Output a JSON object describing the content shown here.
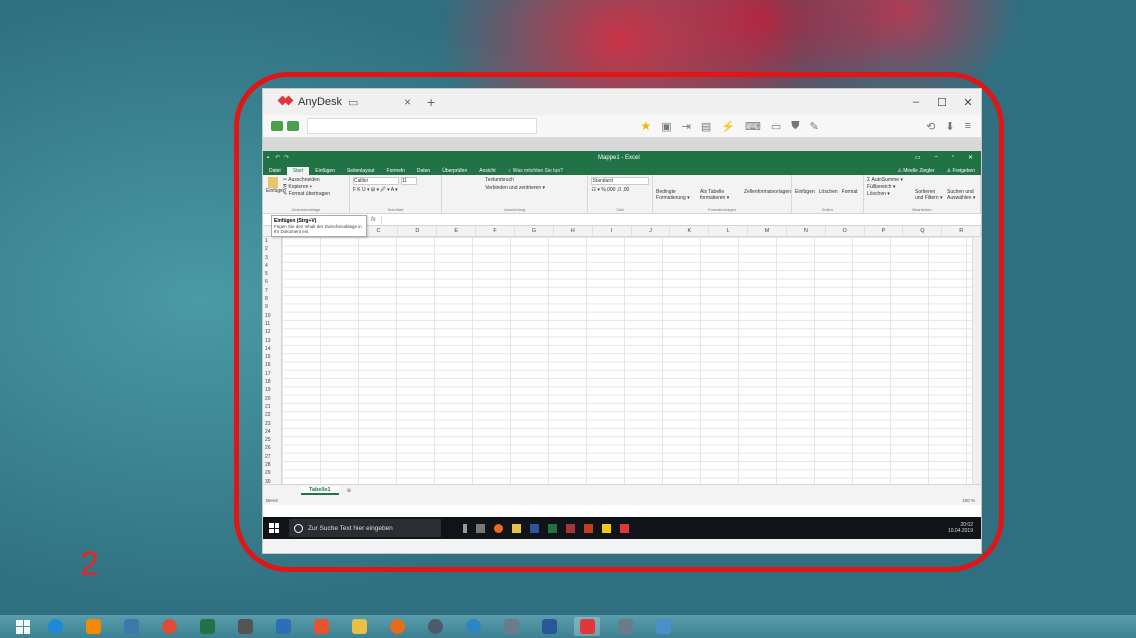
{
  "annotations": {
    "label_1": "1",
    "label_2": "2"
  },
  "anydesk": {
    "tab_title": "AnyDesk",
    "tab_close": "×",
    "new_tab": "+",
    "window_controls": [
      "–",
      "☐",
      "✕"
    ],
    "brand_color": "#e3363b"
  },
  "excel": {
    "window_title": "Mappe1 - Excel",
    "window_controls": [
      "▭",
      "–",
      "▫",
      "✕"
    ],
    "ribbon_tabs": [
      "Datei",
      "Start",
      "Einfügen",
      "Seitenlayout",
      "Formeln",
      "Daten",
      "Überprüfen",
      "Ansicht"
    ],
    "active_tab": "Start",
    "tell_me": "♀ Was möchten Sie tun?",
    "user": "⚠ Mirelle Ziegler",
    "share": "♙ Freigeben",
    "clipboard": {
      "paste": "Einfügen",
      "cut": "✂ Ausschneiden",
      "copy": "⎘ Kopieren ▾",
      "format_painter": "✎ Format übertragen",
      "group": "Zwischenablage"
    },
    "font": {
      "name": "Calibri",
      "size": "11",
      "row2": "F K U ▾ ⊞ ▾ 🖉 ▾ A ▾",
      "group": "Schriftart"
    },
    "alignment": {
      "wrap": "Textumbruch",
      "merge": "Verbinden und zentrieren ▾",
      "group": "Ausrichtung"
    },
    "number": {
      "format": "Standard",
      "row2": "☷ ▾ % 000 ,0 ,00",
      "group": "Zahl"
    },
    "styles": {
      "conditional": "Bedingte Formatierung ▾",
      "as_table": "Als Tabelle formatieren ▾",
      "cell_styles": "Zellenformatvorlagen",
      "group": "Formatvorlagen"
    },
    "cells": {
      "insert": "Einfügen",
      "delete": "Löschen",
      "format": "Format",
      "group": "Zellen"
    },
    "editing": {
      "autosum": "Σ AutoSumme ▾",
      "fill": "Füllbereich ▾",
      "clear": "Löschen ▾",
      "sort": "Sortieren und Filtern ▾",
      "find": "Suchen und Auswählen ▾",
      "group": "Bearbeiten"
    },
    "tooltip": {
      "title": "Einfügen (Strg+V)",
      "text": "Fügen Sie den Inhalt der Zwischenablage in Ihr Dokument ein."
    },
    "fx": "fx",
    "columns": [
      "A",
      "B",
      "C",
      "D",
      "E",
      "F",
      "G",
      "H",
      "I",
      "J",
      "K",
      "L",
      "M",
      "N",
      "O",
      "P",
      "Q",
      "R"
    ],
    "rows": [
      "1",
      "2",
      "3",
      "4",
      "5",
      "6",
      "7",
      "8",
      "9",
      "10",
      "11",
      "12",
      "13",
      "14",
      "15",
      "16",
      "17",
      "18",
      "19",
      "20",
      "21",
      "22",
      "23",
      "24",
      "25",
      "26",
      "27",
      "28",
      "29",
      "30"
    ],
    "sheet_tab": "Tabelle1",
    "add_sheet": "⊕",
    "status_left": "Bereit",
    "zoom": "100 %",
    "accent": "#217346"
  },
  "inner_taskbar": {
    "search_placeholder": "Zur Suche Text hier eingeben",
    "time": "20:02",
    "date": "10.04.2019"
  }
}
